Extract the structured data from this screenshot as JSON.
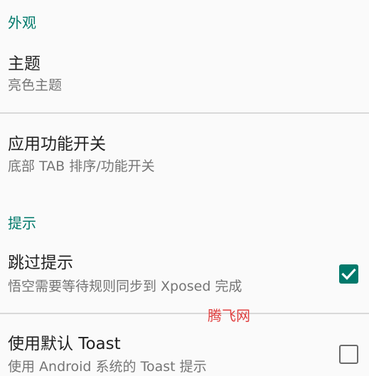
{
  "sections": [
    {
      "header": "外观",
      "items": [
        {
          "title": "主题",
          "summary": "亮色主题"
        },
        {
          "title": "应用功能开关",
          "summary": "底部 TAB 排序/功能开关"
        }
      ]
    },
    {
      "header": "提示",
      "items": [
        {
          "title": "跳过提示",
          "summary": "悟空需要等待规则同步到 Xposed 完成",
          "checked": true
        },
        {
          "title": "使用默认 Toast",
          "summary": "使用 Android 系统的 Toast 提示",
          "checked": false
        }
      ]
    }
  ],
  "watermark": "腾飞网",
  "colors": {
    "accent": "#00796b",
    "title": "#212121",
    "summary": "#757575",
    "divider": "#d9d9d9",
    "background": "#fafafa"
  }
}
